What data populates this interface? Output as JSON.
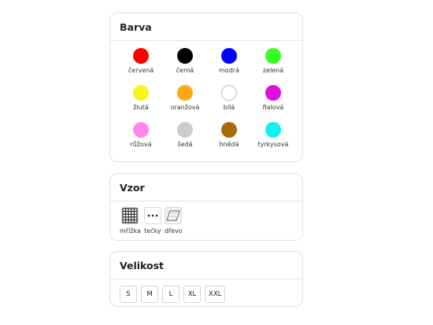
{
  "color_section": {
    "title": "Barva",
    "colors": [
      {
        "label": "červená",
        "hex": "#ff0000"
      },
      {
        "label": "černá",
        "hex": "#000000"
      },
      {
        "label": "modrá",
        "hex": "#0000ff"
      },
      {
        "label": "zelená",
        "hex": "#33ff22"
      },
      {
        "label": "žlutá",
        "hex": "#f5f51a"
      },
      {
        "label": "oranžová",
        "hex": "#ffaa11"
      },
      {
        "label": "bílá",
        "hex": "#ffffff"
      },
      {
        "label": "fialová",
        "hex": "#dd11dd"
      },
      {
        "label": "růžová",
        "hex": "#ff88ee"
      },
      {
        "label": "šedá",
        "hex": "#cccccc"
      },
      {
        "label": "hnědá",
        "hex": "#a86b08"
      },
      {
        "label": "tyrkysová",
        "hex": "#11f2ee"
      }
    ]
  },
  "pattern_section": {
    "title": "Vzor",
    "items": [
      {
        "label": "mřížka",
        "icon": "grid-icon"
      },
      {
        "label": "tečky",
        "icon": "dots-icon"
      },
      {
        "label": "dřevo",
        "icon": "wood-icon"
      }
    ]
  },
  "size_section": {
    "title": "Velikost",
    "sizes": [
      "S",
      "M",
      "L",
      "XL",
      "XXL"
    ]
  }
}
